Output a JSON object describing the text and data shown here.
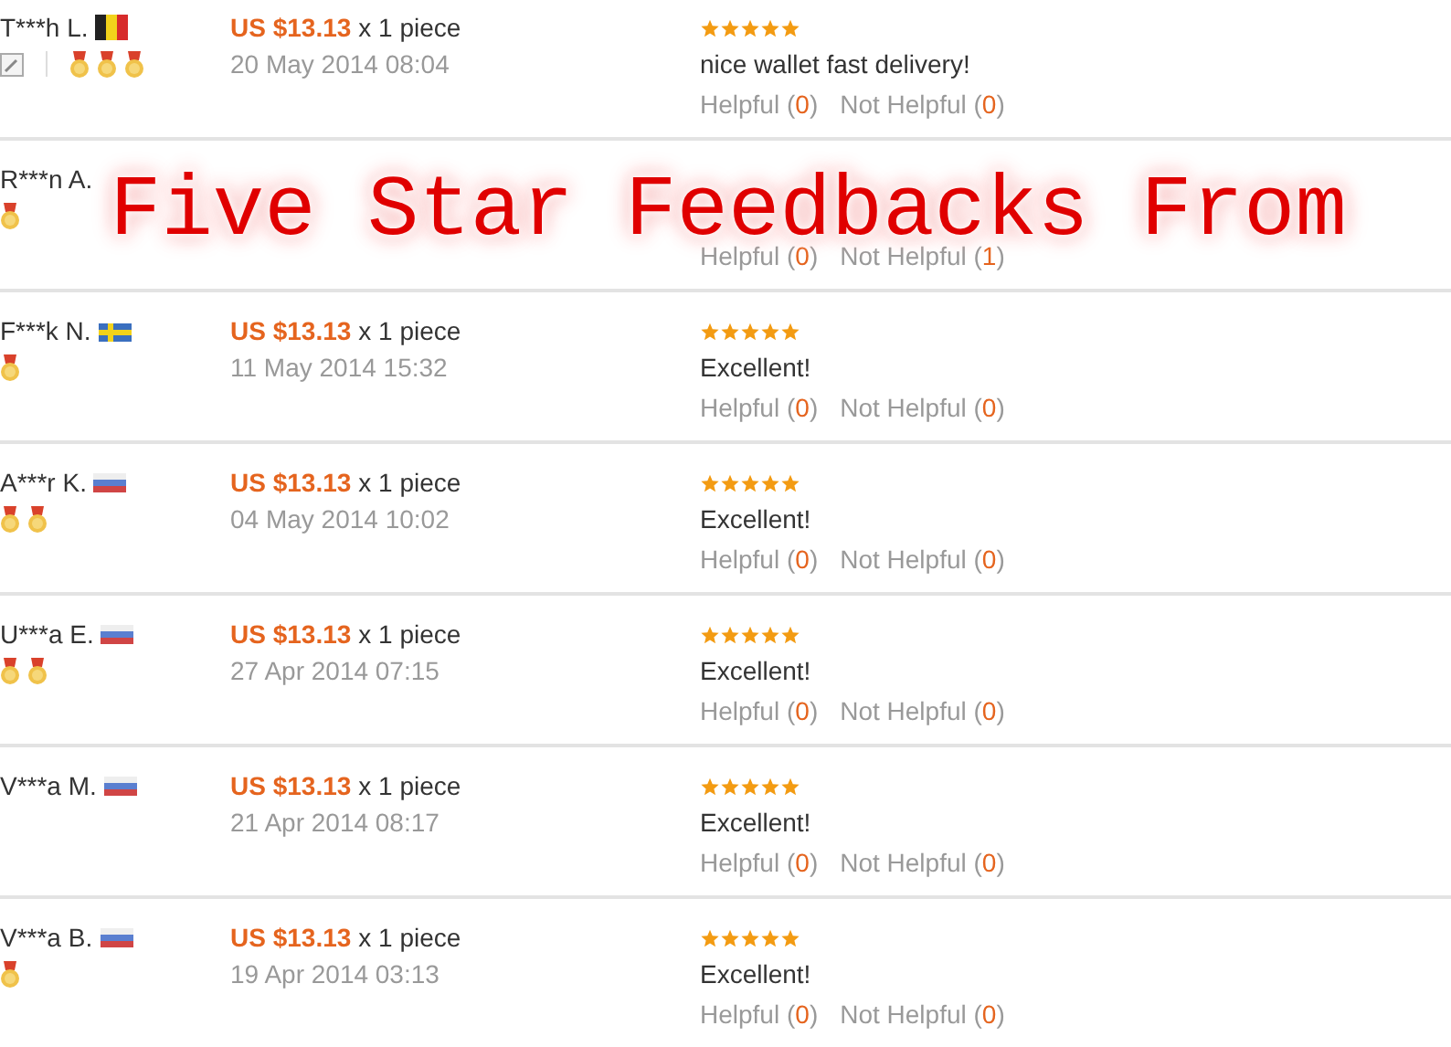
{
  "overlay_title": "Five Star Feedbacks From",
  "feedbacks": [
    {
      "buyer": "T***h L.",
      "flag": {
        "kind": "vertical",
        "stripes": [
          {
            "color": "#222222"
          },
          {
            "color": "#f2d21b"
          },
          {
            "color": "#d72b2b"
          }
        ]
      },
      "note_icon": true,
      "medals": [
        {
          "kind": "medal"
        },
        {
          "kind": "medal"
        },
        {
          "kind": "medal"
        }
      ],
      "price": "US $13.13",
      "quantity": "x 1 piece",
      "date": "20 May 2014 08:04",
      "stars": 5,
      "comment": "nice wallet fast delivery!",
      "helpful": "Helpful (0)",
      "not_helpful": "Not Helpful (0)"
    },
    {
      "buyer": "R***n A.",
      "note_icon": false,
      "medals": [
        {
          "kind": "medal"
        }
      ],
      "helpful": "Helpful (0)",
      "not_helpful": "Not Helpful (1)"
    },
    {
      "buyer": "F***k N.",
      "flag": {
        "kind": "cross",
        "stripes": [
          {
            "color": "#3a6fbf"
          },
          {
            "color": "#f2d21b"
          }
        ]
      },
      "note_icon": false,
      "medals": [
        {
          "kind": "medal"
        }
      ],
      "price": "US $13.13",
      "quantity": "x 1 piece",
      "date": "11 May 2014 15:32",
      "stars": 5,
      "comment": "Excellent!",
      "helpful": "Helpful (0)",
      "not_helpful": "Not Helpful (0)"
    },
    {
      "buyer": "A***r K.",
      "flag": {
        "kind": "horizontal",
        "stripes": [
          {
            "color": "#eeeeee"
          },
          {
            "color": "#5a7fd0"
          },
          {
            "color": "#d04545"
          }
        ]
      },
      "note_icon": false,
      "medals": [
        {
          "kind": "medal"
        },
        {
          "kind": "medal"
        }
      ],
      "price": "US $13.13",
      "quantity": "x 1 piece",
      "date": "04 May 2014 10:02",
      "stars": 5,
      "comment": "Excellent!",
      "helpful": "Helpful (0)",
      "not_helpful": "Not Helpful (0)"
    },
    {
      "buyer": "U***a E.",
      "flag": {
        "kind": "horizontal",
        "stripes": [
          {
            "color": "#eeeeee"
          },
          {
            "color": "#5a7fd0"
          },
          {
            "color": "#d04545"
          }
        ]
      },
      "note_icon": false,
      "medals": [
        {
          "kind": "medal"
        },
        {
          "kind": "medal"
        }
      ],
      "price": "US $13.13",
      "quantity": "x 1 piece",
      "date": "27 Apr 2014 07:15",
      "stars": 5,
      "comment": "Excellent!",
      "helpful": "Helpful (0)",
      "not_helpful": "Not Helpful (0)"
    },
    {
      "buyer": "V***a M.",
      "flag": {
        "kind": "horizontal",
        "stripes": [
          {
            "color": "#eeeeee"
          },
          {
            "color": "#5a7fd0"
          },
          {
            "color": "#d04545"
          }
        ]
      },
      "note_icon": false,
      "price": "US $13.13",
      "quantity": "x 1 piece",
      "date": "21 Apr 2014 08:17",
      "stars": 5,
      "comment": "Excellent!",
      "helpful": "Helpful (0)",
      "not_helpful": "Not Helpful (0)"
    },
    {
      "buyer": "V***a B.",
      "flag": {
        "kind": "horizontal",
        "stripes": [
          {
            "color": "#eeeeee"
          },
          {
            "color": "#5a7fd0"
          },
          {
            "color": "#d04545"
          }
        ]
      },
      "note_icon": false,
      "medals": [
        {
          "kind": "medal"
        }
      ],
      "price": "US $13.13",
      "quantity": "x 1 piece",
      "date": "19 Apr 2014 03:13",
      "stars": 5,
      "comment": "Excellent!",
      "helpful": "Helpful (0)",
      "not_helpful": "Not Helpful (0)"
    }
  ]
}
